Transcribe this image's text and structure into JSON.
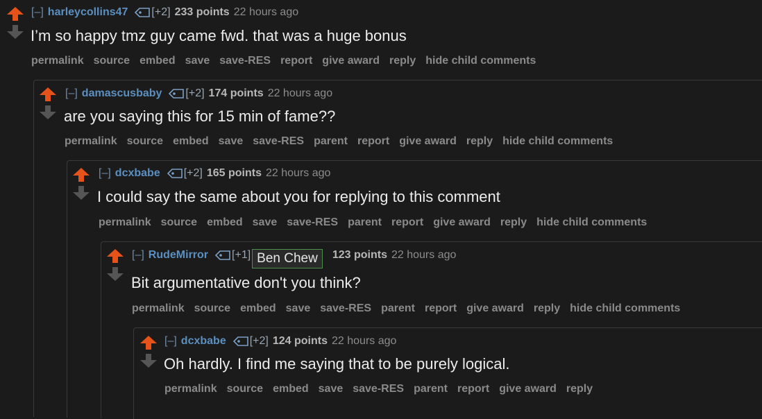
{
  "comments": [
    {
      "collapse": "[–]",
      "author": "harleycollins47",
      "score_mod": "[+2]",
      "points": "233 points",
      "time": "22 hours ago",
      "body": "I’m so happy tmz guy came fwd. that was a huge bonus",
      "buttons": [
        "permalink",
        "source",
        "embed",
        "save",
        "save-RES",
        "report",
        "give award",
        "reply",
        "hide child comments"
      ]
    },
    {
      "collapse": "[–]",
      "author": "damascusbaby",
      "score_mod": "[+2]",
      "points": "174 points",
      "time": "22 hours ago",
      "body": "are you saying this for 15 min of fame??",
      "buttons": [
        "permalink",
        "source",
        "embed",
        "save",
        "save-RES",
        "parent",
        "report",
        "give award",
        "reply",
        "hide child comments"
      ]
    },
    {
      "collapse": "[–]",
      "author": "dcxbabe",
      "score_mod": "[+2]",
      "points": "165 points",
      "time": "22 hours ago",
      "body": "I could say the same about you for replying to this comment",
      "buttons": [
        "permalink",
        "source",
        "embed",
        "save",
        "save-RES",
        "parent",
        "report",
        "give award",
        "reply",
        "hide child comments"
      ]
    },
    {
      "collapse": "[–]",
      "author": "RudeMirror",
      "score_mod": "[+1]",
      "flair": "Ben Chew",
      "points": "123 points",
      "time": "22 hours ago",
      "body": "Bit argumentative don't you think?",
      "buttons": [
        "permalink",
        "source",
        "embed",
        "save",
        "save-RES",
        "parent",
        "report",
        "give award",
        "reply",
        "hide child comments"
      ]
    },
    {
      "collapse": "[–]",
      "author": "dcxbabe",
      "score_mod": "[+2]",
      "points": "124 points",
      "time": "22 hours ago",
      "body": "Oh hardly. I find me saying that to be purely logical.",
      "buttons": [
        "permalink",
        "source",
        "embed",
        "save",
        "save-RES",
        "parent",
        "report",
        "give award",
        "reply"
      ]
    }
  ],
  "colors": {
    "upvote": "#e5531a",
    "downvote": "#555555",
    "author": "#5b8fc0",
    "flair_border": "#4b8f4b"
  },
  "icons": {
    "upvote": "upvote-arrow-icon",
    "downvote": "downvote-arrow-icon",
    "tag": "user-tag-icon"
  }
}
